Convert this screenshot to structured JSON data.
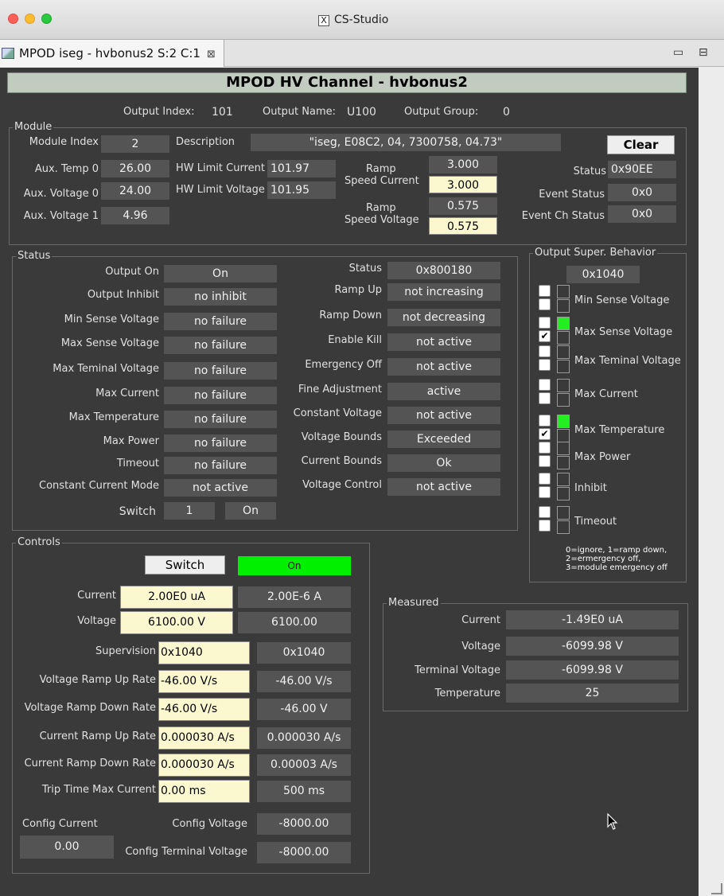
{
  "window": {
    "title": "CS-Studio",
    "x_icon": "X"
  },
  "tab": {
    "label": "MPOD iseg - hvbonus2 S:2 C:1",
    "close": "⊠"
  },
  "header": {
    "title": "MPOD HV Channel - hvbonus2"
  },
  "output": {
    "index_label": "Output Index:",
    "index": "101",
    "name_label": "Output Name:",
    "name": "U100",
    "group_label": "Output Group:",
    "group": "0"
  },
  "module": {
    "title": "Module",
    "index_label": "Module Index",
    "index": "2",
    "desc_label": "Description",
    "desc": "\"iseg, E08C2, 04, 7300758, 04.73\"",
    "clear": "Clear",
    "temp_label": "Aux. Temp 0",
    "temp": "26.00",
    "aux_v0_label": "Aux. Voltage 0",
    "aux_v0": "24.00",
    "aux_v1_label": "Aux. Voltage 1",
    "aux_v1": "4.96",
    "hwlc_label": "HW Limit Current",
    "hwlc": "101.97",
    "hwlv_label": "HW Limit Voltage",
    "hwlv": "101.95",
    "rsc_label1": "Ramp",
    "rsc_label2": "Speed Current",
    "rsc_ro": "3.000",
    "rsc_in": "3.000",
    "rsv_label1": "Ramp",
    "rsv_label2": "Speed Voltage",
    "rsv_ro": "0.575",
    "rsv_in": "0.575",
    "status_label": "Status",
    "status": "0x90EE",
    "event_label": "Event Status",
    "event": "0x0",
    "evch_label": "Event Ch Status",
    "evch": "0x0"
  },
  "status": {
    "title": "Status",
    "left": [
      {
        "label": "Output On",
        "value": "On"
      },
      {
        "label": "Output Inhibit",
        "value": "no inhibit"
      },
      {
        "label": "Min Sense Voltage",
        "value": "no failure"
      },
      {
        "label": "Max Sense Voltage",
        "value": "no failure"
      },
      {
        "label": "Max Teminal Voltage",
        "value": "no failure"
      },
      {
        "label": "Max Current",
        "value": "no failure"
      },
      {
        "label": "Max Temperature",
        "value": "no failure"
      },
      {
        "label": "Max Power",
        "value": "no failure"
      },
      {
        "label": "Timeout",
        "value": "no failure"
      },
      {
        "label": "Constant Current Mode",
        "value": "not active"
      }
    ],
    "right": [
      {
        "label": "Status",
        "value": "0x800180"
      },
      {
        "label": "Ramp Up",
        "value": "not increasing"
      },
      {
        "label": "Ramp Down",
        "value": "not decreasing"
      },
      {
        "label": "Enable Kill",
        "value": "not active"
      },
      {
        "label": "Emergency Off",
        "value": "not active"
      },
      {
        "label": "Fine Adjustment",
        "value": "active"
      },
      {
        "label": "Constant Voltage",
        "value": "not active"
      },
      {
        "label": "Voltage Bounds",
        "value": "Exceeded"
      },
      {
        "label": "Current Bounds",
        "value": "Ok"
      },
      {
        "label": "Voltage Control",
        "value": "not active"
      }
    ],
    "switch_label": "Switch",
    "switch_value": "1",
    "switch_state": "On"
  },
  "osb": {
    "title": "Output Super. Behavior",
    "value": "0x1040",
    "items": [
      {
        "label": "Min Sense Voltage",
        "checked": false,
        "led": false
      },
      {
        "label": "Max Sense Voltage",
        "checked": true,
        "led": true
      },
      {
        "label": "Max Teminal Voltage",
        "checked": false,
        "led": false
      },
      {
        "label": "Max Current",
        "checked": false,
        "led": false
      },
      {
        "label": "Max Temperature",
        "checked": true,
        "led": true
      },
      {
        "label": "Max Power",
        "checked": false,
        "led": false
      },
      {
        "label": "Inhibit",
        "checked": false,
        "led": false
      },
      {
        "label": "Timeout",
        "checked": false,
        "led": false
      }
    ],
    "legend1": "0=ignore, 1=ramp down,",
    "legend2": "2=ermergency off,",
    "legend3": "3=module emergency off"
  },
  "controls": {
    "title": "Controls",
    "switch_btn": "Switch",
    "switch_state": "On",
    "rows": [
      {
        "label": "Current",
        "input": "2.00E0 uA",
        "readback": "2.00E-6 A"
      },
      {
        "label": "Voltage",
        "input": "6100.00 V",
        "readback": "6100.00"
      },
      {
        "label": "Supervision",
        "input": "0x1040",
        "readback": "0x1040"
      },
      {
        "label": "Voltage Ramp Up Rate",
        "input": "-46.00 V/s",
        "readback": "-46.00 V/s"
      },
      {
        "label": "Voltage Ramp Down Rate",
        "input": "-46.00 V/s",
        "readback": "-46.00 V"
      },
      {
        "label": "Current Ramp Up Rate",
        "input": "0.000030 A/s",
        "readback": "0.000030 A/s"
      },
      {
        "label": "Current Ramp Down Rate",
        "input": "0.000030 A/s",
        "readback": "0.00003 A/s"
      },
      {
        "label": "Trip Time Max Current",
        "input": "0.00 ms",
        "readback": "500 ms"
      }
    ],
    "config_current_label": "Config Current",
    "config_current": "0.00",
    "config_voltage_label": "Config Voltage",
    "config_voltage": "-8000.00",
    "config_term_label": "Config Terminal Voltage",
    "config_term": "-8000.00"
  },
  "measured": {
    "title": "Measured",
    "rows": [
      {
        "label": "Current",
        "value": "-1.49E0 uA"
      },
      {
        "label": "Voltage",
        "value": "-6099.98 V"
      },
      {
        "label": "Terminal Voltage",
        "value": "-6099.98 V"
      },
      {
        "label": "Temperature",
        "value": "25"
      }
    ]
  },
  "colors": {
    "panel": "#3a3a3a",
    "field": "#545454",
    "input": "#fbf8d0",
    "led_on": "#22ee22",
    "header": "#c2cbc0"
  }
}
